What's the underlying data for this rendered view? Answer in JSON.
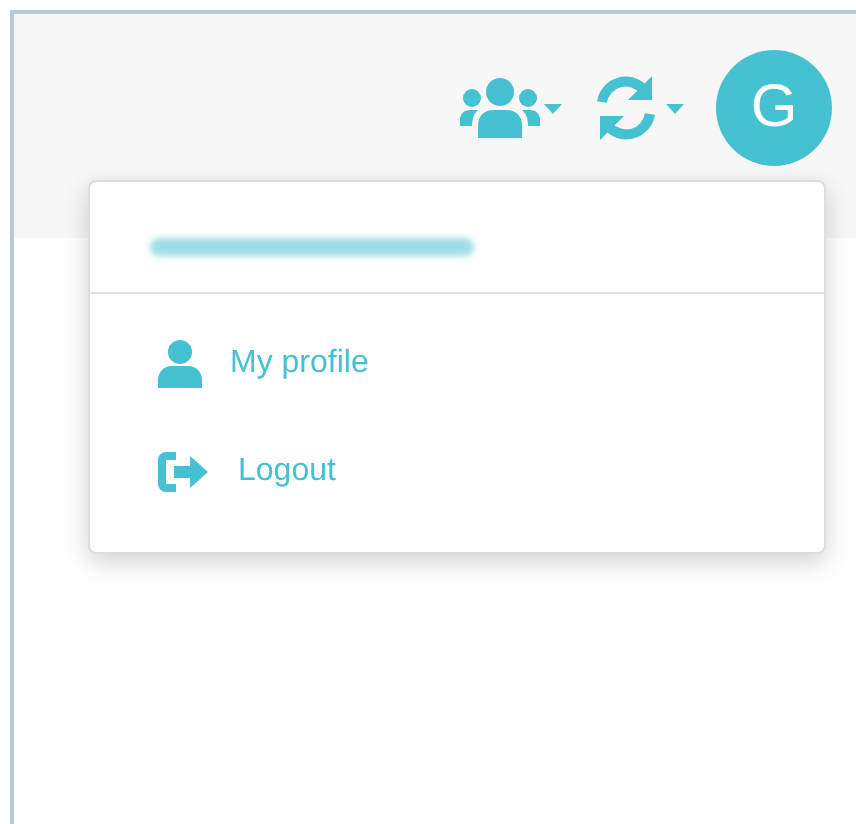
{
  "header": {
    "avatar": "G"
  },
  "menu": {
    "items": [
      {
        "kind": "profile",
        "label": "My profile"
      },
      {
        "kind": "logout",
        "label": "Logout"
      }
    ]
  }
}
